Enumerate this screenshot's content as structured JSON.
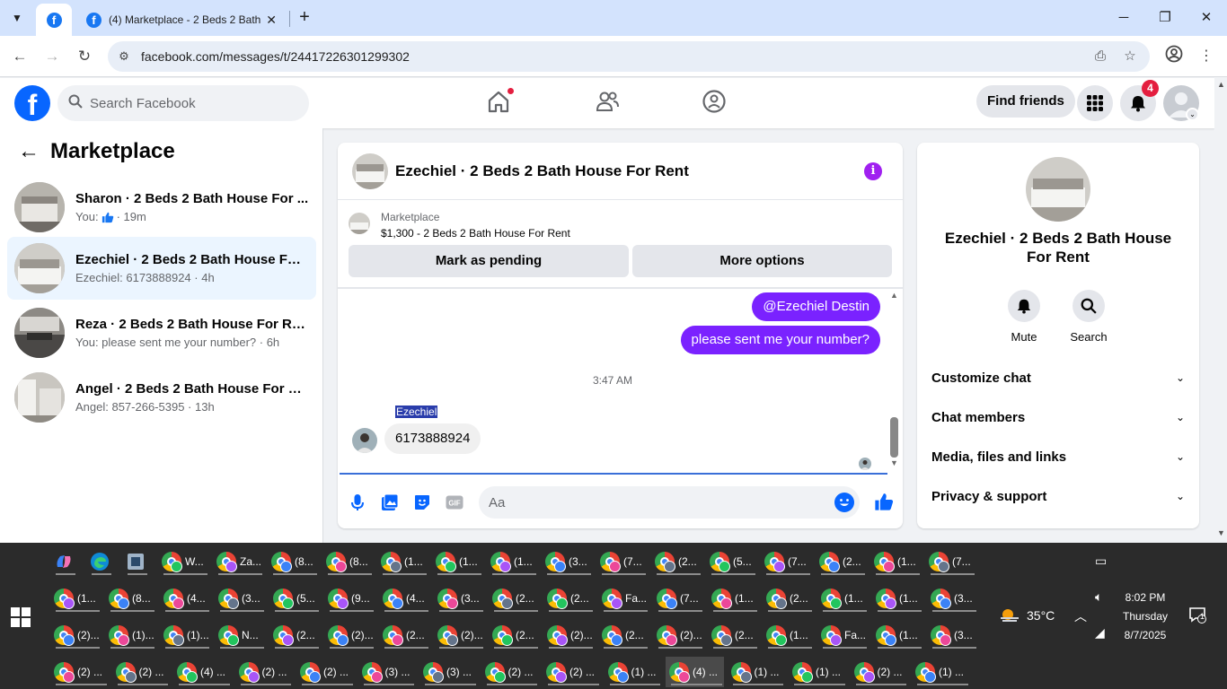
{
  "browser": {
    "tab_title": "(4) Marketplace - 2 Beds 2 Bath",
    "url": "facebook.com/messages/t/24417226301299302"
  },
  "fb": {
    "search_placeholder": "Search Facebook",
    "find_friends": "Find friends",
    "notif_count": "4"
  },
  "sidebar": {
    "title": "Marketplace",
    "conversations": [
      {
        "name": "Sharon · 2 Beds 2 Bath House For ...",
        "prefix": "You:",
        "suffix": "· 19m",
        "has_like": true
      },
      {
        "name": "Ezechiel · 2 Beds 2 Bath House For...",
        "sub": "Ezechiel: 6173888924 · 4h"
      },
      {
        "name": "Reza · 2 Beds 2 Bath House For Rent",
        "sub": "You: please sent me your number? · 6h"
      },
      {
        "name": "Angel · 2 Beds 2 Bath House For R...",
        "sub": "Angel: 857-266-5395 · 13h"
      }
    ]
  },
  "chat": {
    "title": "Ezechiel · 2 Beds 2 Bath House For Rent",
    "listing_label": "Marketplace",
    "listing_price": "$1,300 - 2 Beds 2 Bath House For Rent",
    "mark_pending": "Mark as pending",
    "more_options": "More options",
    "msg_mention": "@Ezechiel Destin",
    "msg_out": "please sent me your number?",
    "timestamp": "3:47 AM",
    "sender": "Ezechiel",
    "msg_in": "6173888924",
    "input_placeholder": "Aa"
  },
  "info_panel": {
    "name": "Ezechiel · 2 Beds 2 Bath House For Rent",
    "mute": "Mute",
    "search": "Search",
    "rows": [
      "Customize chat",
      "Chat members",
      "Media, files and links",
      "Privacy & support"
    ]
  },
  "taskbar": {
    "row1": [
      "W...",
      "Za...",
      "(8...",
      "(8...",
      "(1...",
      "(1...",
      "(1...",
      "(3...",
      "(7...",
      "(2...",
      "(5...",
      "(7...",
      "(2...",
      "(1...",
      "(7..."
    ],
    "row2": [
      "(1...",
      "(8...",
      "(4...",
      "(3...",
      "(5...",
      "(9...",
      "(4...",
      "(3...",
      "(2...",
      "(2...",
      "Fa...",
      "(7...",
      "(1...",
      "(2...",
      "(1...",
      "(1...",
      "(3..."
    ],
    "row3": [
      "(2)...",
      "(1)...",
      "(1)...",
      "N...",
      "(2...",
      "(2)...",
      "(2...",
      "(2)...",
      "(2...",
      "(2)...",
      "(2...",
      "(2)...",
      "(2...",
      "(1...",
      "Fa...",
      "(1...",
      "(3..."
    ],
    "row4": [
      "(2) ...",
      "(2) ...",
      "(4) ...",
      "(2) ...",
      "(2) ...",
      "(3) ...",
      "(3) ...",
      "(2) ...",
      "(2) ...",
      "(1) ...",
      "(4) ...",
      "(1) ...",
      "(1) ...",
      "(2) ...",
      "(1) ..."
    ],
    "temperature": "35°C",
    "time": "8:02 PM",
    "day": "Thursday",
    "date": "8/7/2025",
    "notif_count": "1"
  }
}
